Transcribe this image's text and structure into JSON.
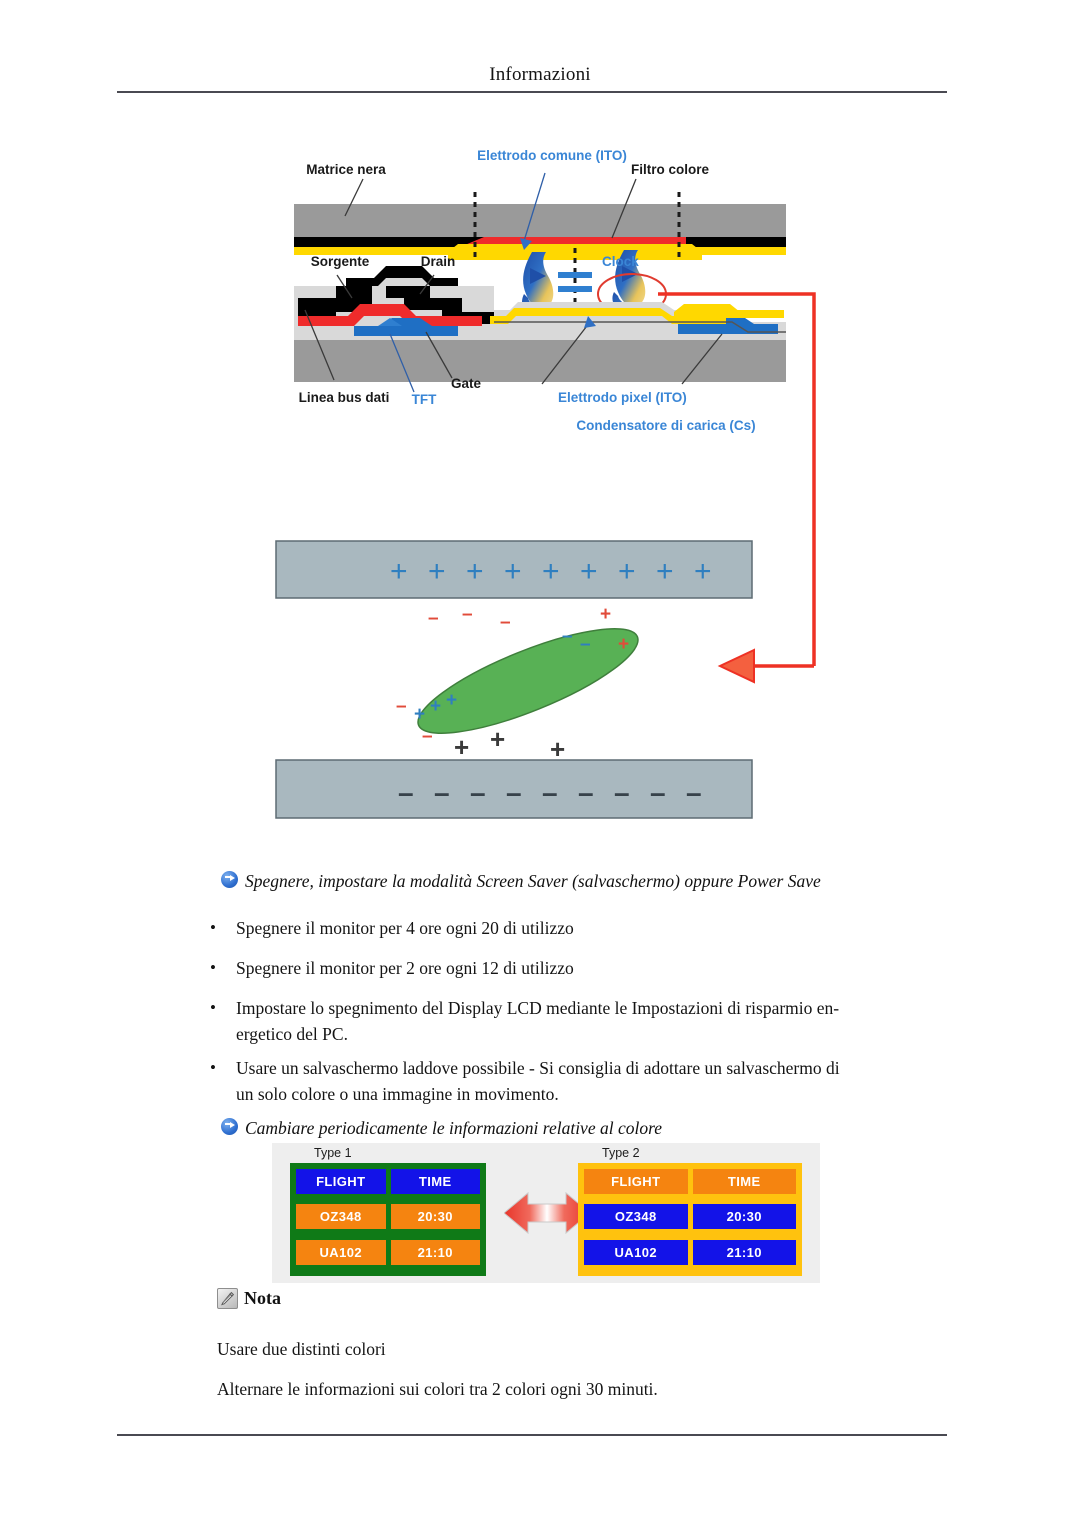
{
  "header": {
    "title": "Informazioni"
  },
  "figure_lcd": {
    "name": "lcd-cross-section-diagram",
    "labels": {
      "matrice_nera": "Matrice nera",
      "elettrodo_comune": "Elettrodo comune (ITO)",
      "filtro_colore": "Filtro colore",
      "sorgente": "Sorgente",
      "drain": "Drain",
      "clock": "Clock",
      "linea_bus_dati": "Linea bus dati",
      "tft": "TFT",
      "gate": "Gate",
      "elettrodo_pixel": "Elettrodo pixel (ITO)",
      "condensatore": "Condensatore di carica (Cs)"
    },
    "colors": {
      "label_blue": "#3a86d6",
      "label_black": "#1a1a1a",
      "glass_gray": "#9a9a9a",
      "black_matrix": "#000000",
      "color_filter_red": "#ef2b2b",
      "ito_yellow": "#ffd800",
      "tft_blue": "#1f6fc4",
      "callout_red": "#ee3124",
      "plate_gray": "#a9b8bf",
      "molecule_green": "#58b155"
    },
    "charge_row_top": "+ + + + + + + + + +",
    "charge_row_bottom": "- - - - - - - - -"
  },
  "section_power": {
    "heading": "Spegnere, impostare la modalità Screen Saver (salvaschermo) oppure Power Save",
    "bullets": [
      "Spegnere il monitor per 4 ore ogni 20 di utilizzo",
      "Spegnere il monitor per 2 ore ogni 12 di utilizzo",
      "Impostare lo spegnimento del Display LCD mediante le Impostazioni di risparmio en-\nergetico del PC.",
      "Usare un salvaschermo laddove possibile - Si consiglia di adottare un salvaschermo di\nun solo colore o una immagine in movimento."
    ],
    "bullet_glyph": "•"
  },
  "section_color": {
    "heading": "Cambiare periodicamente le informazioni relative al colore",
    "figure": {
      "name": "flight-info-color-comparison",
      "type1": {
        "label": "Type 1",
        "border_color": "#0f7a17",
        "header_cells": [
          "FLIGHT",
          "TIME"
        ],
        "header_bg": "#1313e8",
        "rows": [
          [
            "OZ348",
            "20:30"
          ],
          [
            "UA102",
            "21:10"
          ]
        ],
        "row_bg": "#f58410"
      },
      "type2": {
        "label": "Type 2",
        "border_color": "#ffc20e",
        "header_cells": [
          "FLIGHT",
          "TIME"
        ],
        "header_bg": "#f58410",
        "rows": [
          [
            "OZ348",
            "20:30"
          ],
          [
            "UA102",
            "21:10"
          ]
        ],
        "row_bg": "#1313e8"
      },
      "arrow": "double-headed-swap-arrow",
      "background": "#eeeeee"
    }
  },
  "note": {
    "label": "Nota",
    "icon": "note-pencil-icon",
    "lines": [
      "Usare due distinti colori",
      "Alternare le informazioni sui colori tra 2 colori ogni 30 minuti."
    ]
  }
}
